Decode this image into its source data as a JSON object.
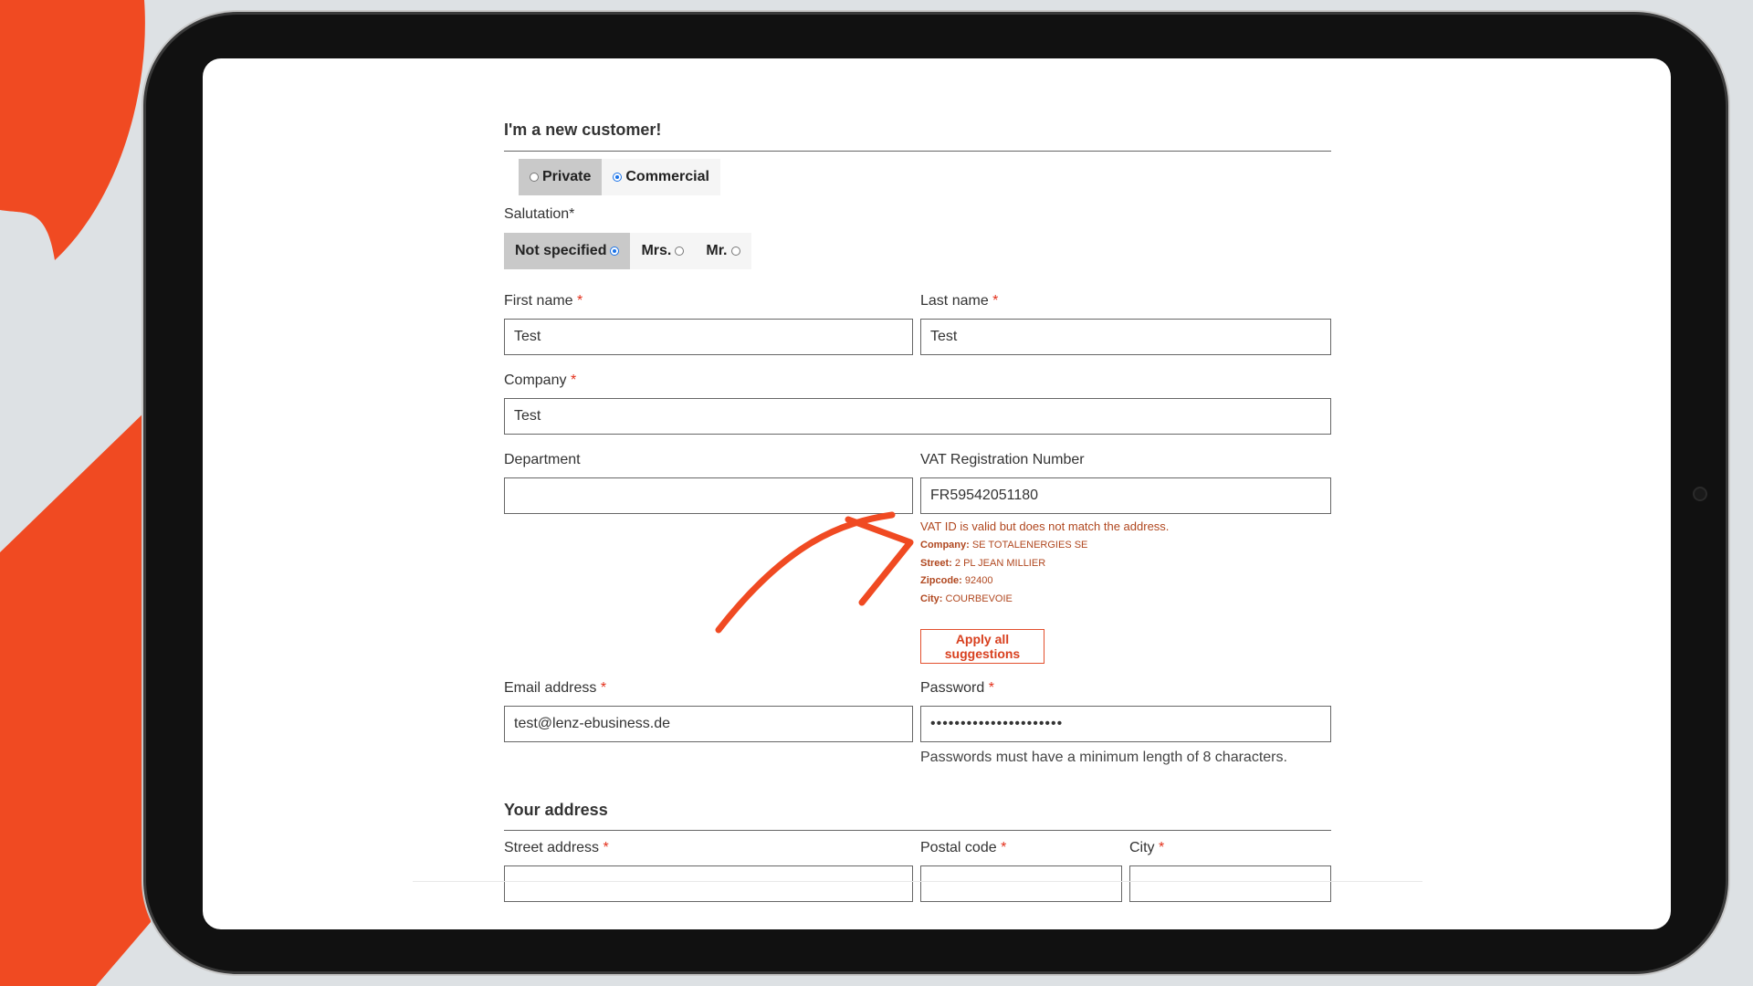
{
  "colors": {
    "accent_orange": "#F04A22",
    "error_text": "#B0471F",
    "radio_blue": "#1A73E8",
    "frame": "#111111"
  },
  "icons": {
    "arrow": "curved-arrow-icon",
    "camera": "camera-icon"
  },
  "form": {
    "heading": "I'm a new customer!",
    "account_types": [
      {
        "label": "Private",
        "selected": false
      },
      {
        "label": "Commercial",
        "selected": true
      }
    ],
    "salutation_label": "Salutation*",
    "salutations": [
      {
        "label": "Not specified",
        "selected": true
      },
      {
        "label": "Mrs.",
        "selected": false
      },
      {
        "label": "Mr.",
        "selected": false
      }
    ],
    "first_name": {
      "label": "First name",
      "required": "*",
      "value": "Test"
    },
    "last_name": {
      "label": "Last name",
      "required": "*",
      "value": "Test"
    },
    "company": {
      "label": "Company",
      "required": "*",
      "value": "Test"
    },
    "department": {
      "label": "Department",
      "value": ""
    },
    "vat": {
      "label": "VAT Registration Number",
      "value": "FR59542051180",
      "message": "VAT ID is valid but does not match the address.",
      "suggestions": [
        {
          "key": "Company:",
          "value": "SE TOTALENERGIES SE"
        },
        {
          "key": "Street:",
          "value": "2 PL JEAN MILLIER"
        },
        {
          "key": "Zipcode:",
          "value": "92400"
        },
        {
          "key": "City:",
          "value": "COURBEVOIE"
        }
      ],
      "apply_label": "Apply all suggestions"
    },
    "email": {
      "label": "Email address",
      "required": "*",
      "value": "test@lenz-ebusiness.de"
    },
    "password": {
      "label": "Password",
      "required": "*",
      "value": "••••••••••••••••••••••",
      "hint": "Passwords must have a minimum length of 8 characters."
    },
    "address_heading": "Your address",
    "street": {
      "label": "Street address",
      "required": "*"
    },
    "postal": {
      "label": "Postal code",
      "required": "*"
    },
    "city": {
      "label": "City",
      "required": "*"
    }
  }
}
